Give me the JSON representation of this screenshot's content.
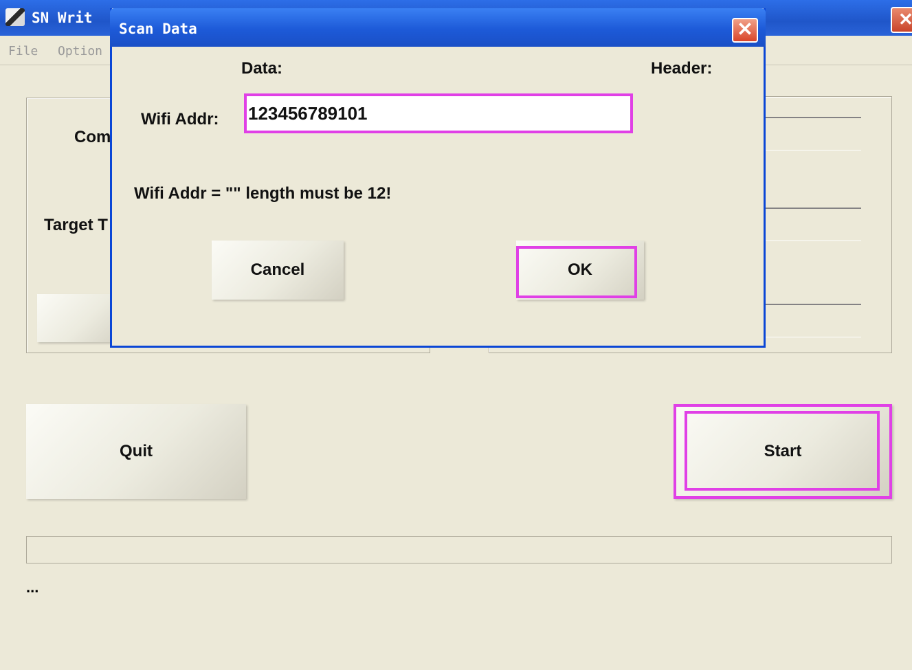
{
  "main_window": {
    "title": "SN Writ",
    "menu": [
      "File",
      "Option"
    ],
    "labels": {
      "com": "Com",
      "target": "Target T"
    },
    "buttons": {
      "quit": "Quit",
      "start": "Start"
    },
    "status": "..."
  },
  "dialog": {
    "title": "Scan Data",
    "close_glyph": "✕",
    "column_headers": {
      "data": "Data:",
      "header": "Header:"
    },
    "wifi_label": "Wifi Addr:",
    "wifi_value": "123456789101",
    "message": "Wifi Addr = \"\" length must be 12!",
    "buttons": {
      "cancel": "Cancel",
      "ok": "OK"
    }
  },
  "colors": {
    "titlebar_blue": "#1f56c9",
    "window_bg": "#ece9d8",
    "highlight": "#e040e6",
    "close_red": "#d9452a"
  }
}
